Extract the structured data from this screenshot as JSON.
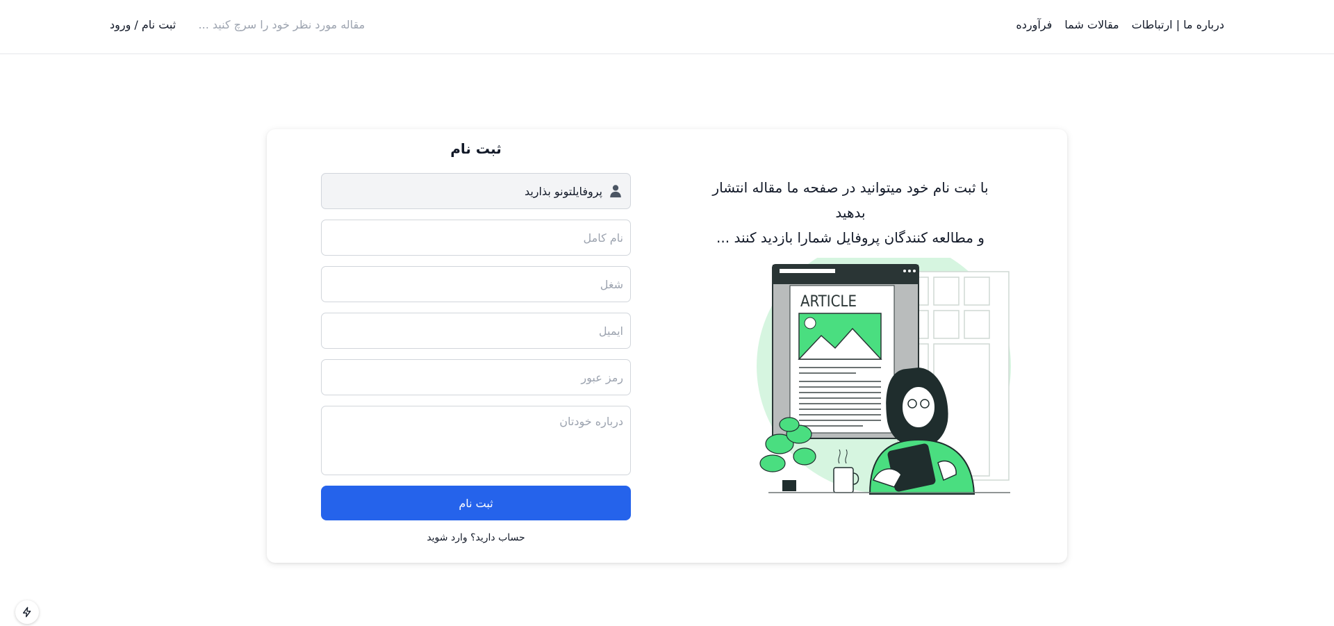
{
  "nav": {
    "links": [
      {
        "label": "فرآورده"
      },
      {
        "label": "مقالات شما"
      },
      {
        "label": "درباره ما | ارتباطات"
      }
    ],
    "auth_label": "ثبت نام / ورود",
    "search_placeholder": "مقاله مورد نظر خود را سرچ کنید ..."
  },
  "form": {
    "title": "ثبت نام",
    "profile_label": "پروفایلتونو بذارید",
    "fullname_placeholder": "نام کامل",
    "job_placeholder": "شغل",
    "email_placeholder": "ایمیل",
    "password_placeholder": "رمز عبور",
    "about_placeholder": "درباره خودتان",
    "submit_label": "ثبت نام",
    "login_prompt": "حساب دارید؟ وارد شوید"
  },
  "info": {
    "line1": "با ثبت نام خود میتوانید در صفحه ما مقاله انتشار بدهید",
    "line2": "و مطالعه کنندگان پروفایل شمارا بازدید کنند ..."
  },
  "illustration": {
    "article_heading": "ARTICLE"
  },
  "colors": {
    "primary": "#2563eb",
    "accent_green": "#4ade80",
    "dark": "#1f2d2d"
  }
}
